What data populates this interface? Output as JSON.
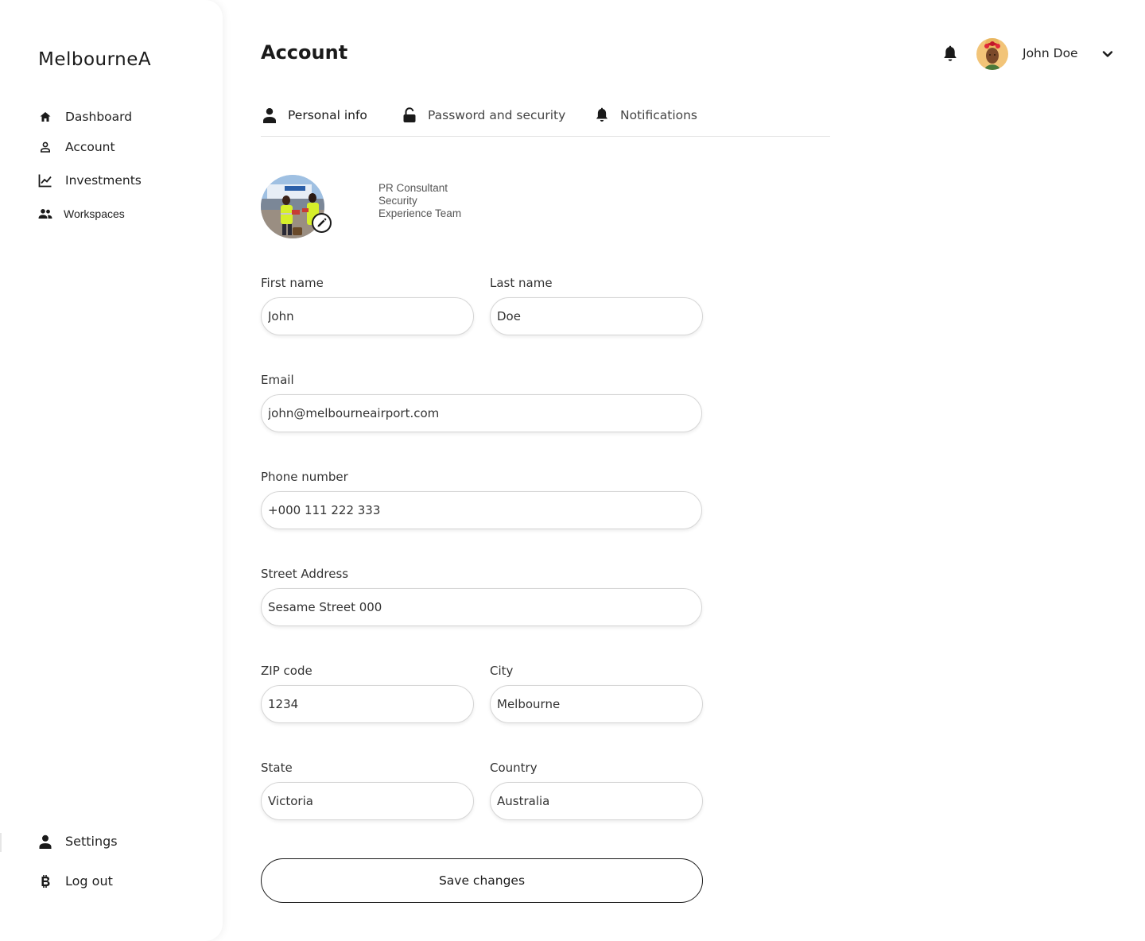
{
  "app": {
    "logo": "MelbourneA"
  },
  "sidebar": {
    "items": [
      {
        "label": "Dashboard",
        "icon": "home-icon"
      },
      {
        "label": "Account",
        "icon": "user-outline-icon"
      },
      {
        "label": "Investments",
        "icon": "line-chart-icon"
      },
      {
        "label": "Workspaces",
        "icon": "people-icon"
      }
    ],
    "bottom": [
      {
        "label": "Settings",
        "icon": "user-filled-icon"
      },
      {
        "label": "Log out",
        "icon": "bitcoin-icon"
      }
    ]
  },
  "header": {
    "title": "Account",
    "user_name": "John Doe"
  },
  "tabs": [
    {
      "label": "Personal info",
      "icon": "person-icon",
      "active": true
    },
    {
      "label": "Password and security",
      "icon": "unlock-icon"
    },
    {
      "label": "Notifications",
      "icon": "bell-icon"
    }
  ],
  "profile": {
    "role_lines": [
      "PR Consultant",
      "Security",
      "Experience Team"
    ]
  },
  "form": {
    "first_name": {
      "label": "First name",
      "value": "John"
    },
    "last_name": {
      "label": "Last name",
      "value": "Doe"
    },
    "email": {
      "label": "Email",
      "value": "john@melbourneairport.com"
    },
    "phone": {
      "label": "Phone number",
      "value": "+000 111 222 333"
    },
    "street": {
      "label": "Street Address",
      "value": "Sesame Street 000"
    },
    "zip": {
      "label": "ZIP code",
      "value": "1234"
    },
    "city": {
      "label": "City",
      "value": "Melbourne"
    },
    "state": {
      "label": "State",
      "value": "Victoria"
    },
    "country": {
      "label": "Country",
      "value": "Australia"
    },
    "save_label": "Save changes"
  }
}
